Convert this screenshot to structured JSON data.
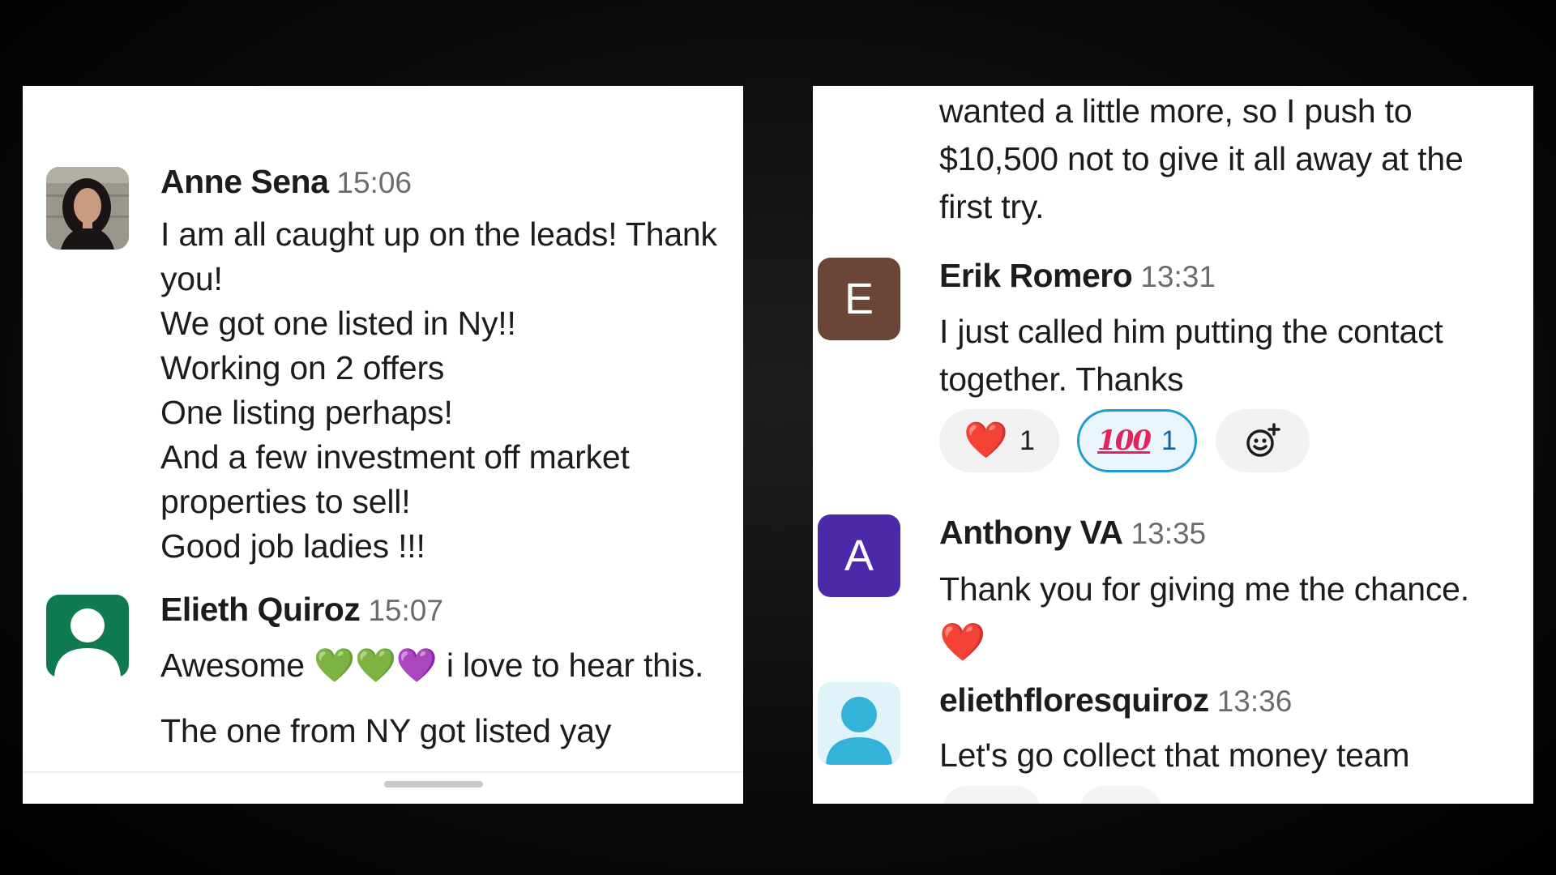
{
  "left_panel": {
    "messages": [
      {
        "author": "Anne Sena",
        "time": "15:06",
        "lines": [
          "I am all caught up on the leads! Thank",
          "you!",
          "We got one listed in Ny!!",
          "Working on 2 offers",
          "One listing perhaps!",
          "And a few investment off market",
          "properties to sell!",
          "Good job ladies !!!"
        ]
      },
      {
        "author": "Elieth Quiroz",
        "time": "15:07",
        "line1_before": "Awesome ",
        "emojis": [
          "💚",
          "💚",
          "💜"
        ],
        "line1_after": " i love to hear this.",
        "line2": "The one from NY got listed yay"
      }
    ]
  },
  "right_panel": {
    "continued_lines": [
      "wanted a little more, so I push to",
      "$10,500 not to give it all away at the",
      "first try."
    ],
    "messages": [
      {
        "author": "Erik Romero",
        "time": "13:31",
        "avatar_letter": "E",
        "avatar_color": "#6b4535",
        "lines": [
          "I just called him putting the contact",
          "together. Thanks"
        ],
        "reactions": [
          {
            "emoji": "❤️",
            "count": "1",
            "selected": false
          },
          {
            "emoji": "100",
            "count": "1",
            "selected": true
          }
        ],
        "add_reaction_icon": "add-reaction-icon"
      },
      {
        "author": "Anthony VA",
        "time": "13:35",
        "avatar_letter": "A",
        "avatar_color": "#4a2aa8",
        "lines": [
          "Thank you for giving me the chance."
        ],
        "trailing_emoji": "❤️"
      },
      {
        "author": "eliethfloresquiroz",
        "time": "13:36",
        "avatar_color": "#d8f1f7",
        "lines": [
          "Let's go collect that money team"
        ]
      }
    ]
  },
  "colors": {
    "green_avatar": "#0f7a4f",
    "accent_blue": "#1d9bd1",
    "person_icon_cyan": "#33b3d9"
  }
}
